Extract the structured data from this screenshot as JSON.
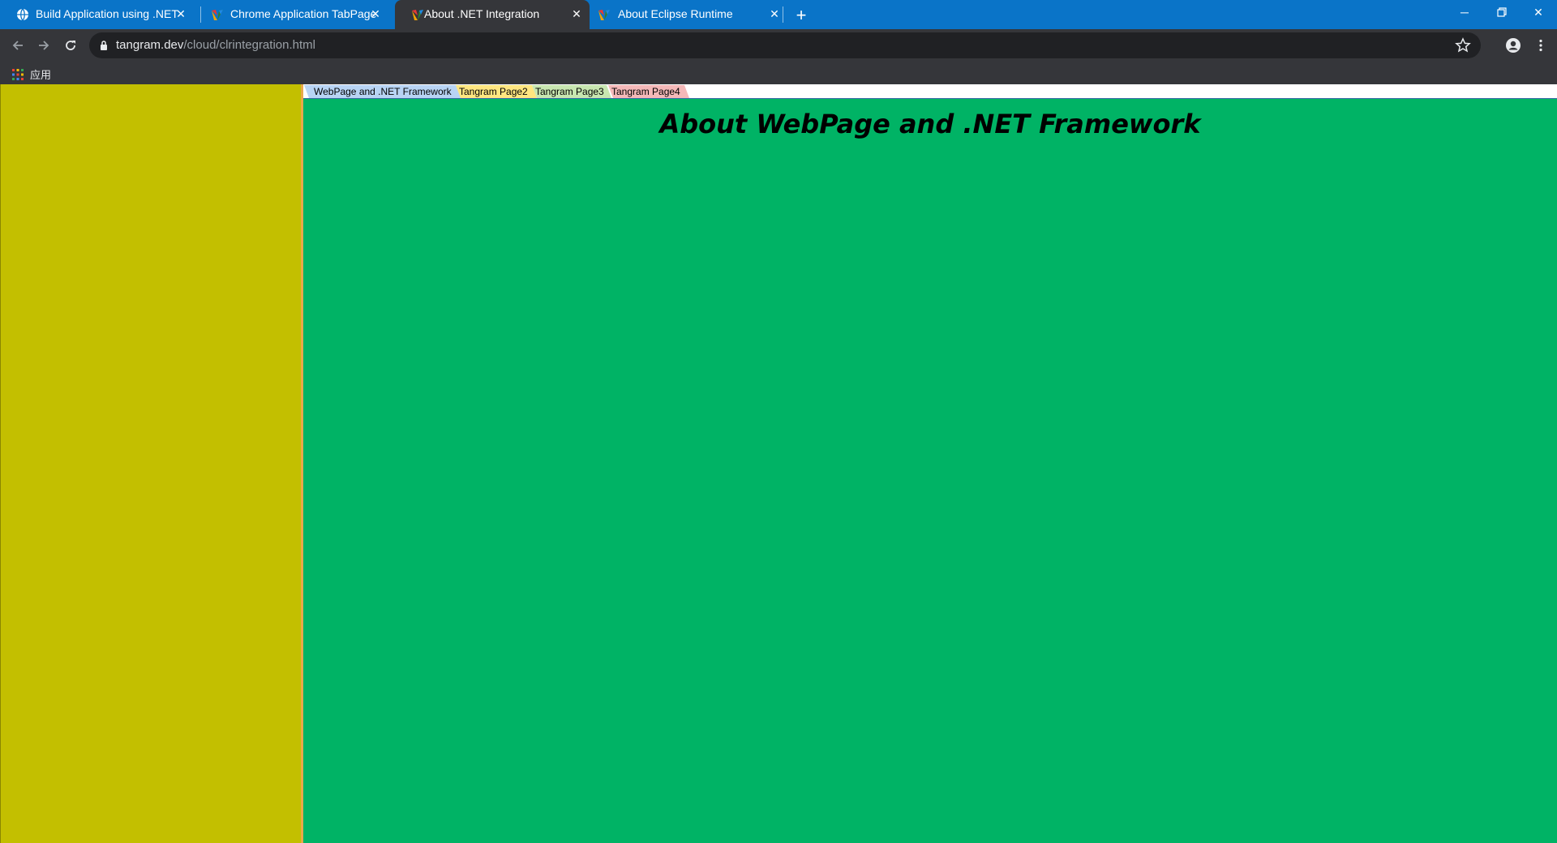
{
  "browser": {
    "tabs": [
      {
        "title": "Build Application using .NET F",
        "favicon": "globe-icon",
        "active": false
      },
      {
        "title": "Chrome Application TabPage",
        "favicon": "tangram-logo-icon",
        "active": false
      },
      {
        "title": "About .NET Integration",
        "favicon": "tangram-logo-icon",
        "active": true
      },
      {
        "title": "About Eclipse Runtime",
        "favicon": "tangram-logo-icon",
        "active": false
      }
    ],
    "url_host": "tangram.dev",
    "url_path": "/cloud/clrintegration.html",
    "bookmarks": {
      "apps_label": "应用"
    }
  },
  "page": {
    "tabs": [
      {
        "label": "WebPage and .NET Framework",
        "color": "#b8d4f4"
      },
      {
        "label": "Tangram Page2",
        "color": "#ffe680"
      },
      {
        "label": "Tangram Page3",
        "color": "#c8e6b0"
      },
      {
        "label": "Tangram Page4",
        "color": "#f4b8b8"
      }
    ],
    "heading": "About WebPage and .NET Framework"
  },
  "colors": {
    "titlebar": "#0a74c8",
    "left_pane": "#c3bf00",
    "splitter": "#e8a94a",
    "right_pane": "#00b365"
  }
}
